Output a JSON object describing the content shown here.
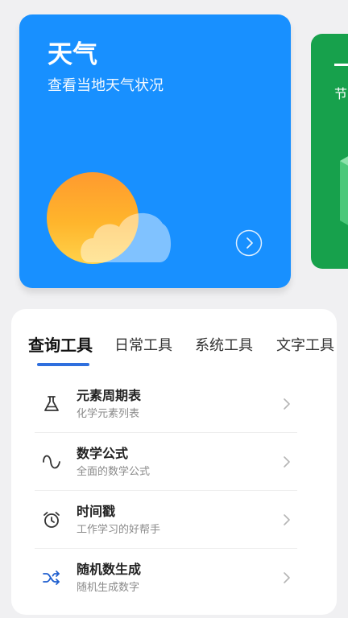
{
  "carousel": {
    "main_card": {
      "title": "天气",
      "subtitle": "查看当地天气状况",
      "illustration_icon": "sun-cloud-icon",
      "arrow_icon": "circle-chevron-right-icon",
      "background_color": "#1890ff"
    },
    "peek_card": {
      "text": "节",
      "background_color": "#17a14c"
    }
  },
  "tabs": [
    {
      "label": "查询工具",
      "active": true
    },
    {
      "label": "日常工具",
      "active": false
    },
    {
      "label": "系统工具",
      "active": false
    },
    {
      "label": "文字工具",
      "active": false
    }
  ],
  "tools": [
    {
      "name": "元素周期表",
      "description": "化学元素列表",
      "icon": "flask-icon"
    },
    {
      "name": "数学公式",
      "description": "全面的数学公式",
      "icon": "sine-wave-icon"
    },
    {
      "name": "时间戳",
      "description": "工作学习的好帮手",
      "icon": "alarm-clock-icon"
    },
    {
      "name": "随机数生成",
      "description": "随机生成数字",
      "icon": "shuffle-icon"
    }
  ],
  "colors": {
    "accent": "#2f6fde",
    "page_background": "#f0f0f2"
  }
}
